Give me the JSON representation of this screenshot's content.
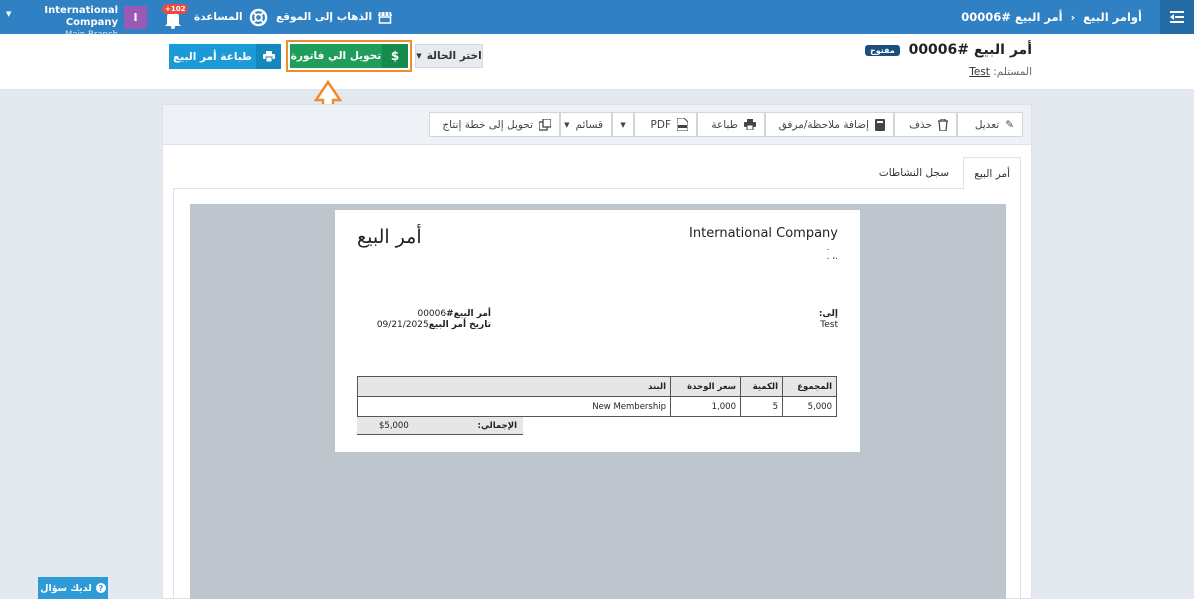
{
  "topbar": {
    "breadcrumb_root": "أوامر البيع",
    "breadcrumb_sep": "‹",
    "breadcrumb_current": "أمر البيع #00006",
    "company_name": "International Company",
    "branch": "Main Branch",
    "avatar_letter": "I",
    "notifications_count": "+102",
    "help_label": "المساعدة",
    "website_label": "الذهاب إلى الموقع"
  },
  "header": {
    "title": "أمر البيع #00006",
    "status_pill": "مفتوح",
    "recipient_label": "المستلم:",
    "recipient_value": "Test",
    "status_select_label": "اختر الحالة",
    "convert_button_label": "تحويل الي فاتورة",
    "print_button_label": "طباعة أمر البيع"
  },
  "toolbar": {
    "edit": "تعديل",
    "delete": "حذف",
    "add_note": "إضافة ملاحظة/مرفق",
    "print": "طباعة",
    "pdf": "PDF",
    "lists": "قسائم",
    "convert_production": "تحويل إلى خطة إنتاج"
  },
  "tabs": {
    "order": "أمر البيع",
    "activity": "سجل النشاطات"
  },
  "document": {
    "company_name": "International Company",
    "company_line1": ".",
    "company_line2": ". ،.",
    "title": "أمر البيع",
    "to_label": "إلى:",
    "to_value": "Test",
    "order_no_label": "أمر البيع#",
    "order_no_value": "00006",
    "order_date_label": "تاريخ أمر البيع",
    "order_date_value": "09/21/2025",
    "table": {
      "headers": [
        "البند",
        "سعر الوحدة",
        "الكمية",
        "المجموع"
      ],
      "rows": [
        [
          "New Membership",
          "1,000",
          "5",
          "5,000"
        ]
      ]
    },
    "total_label": "الإجمالي:",
    "total_value": "$5,000"
  },
  "help_button": "لديك سؤال",
  "colors": {
    "topbar": "#2f81c4",
    "convert": "#1e9e5a",
    "print": "#1a9ad6",
    "highlight": "#f28a2e",
    "avatar": "#9b59b6"
  }
}
